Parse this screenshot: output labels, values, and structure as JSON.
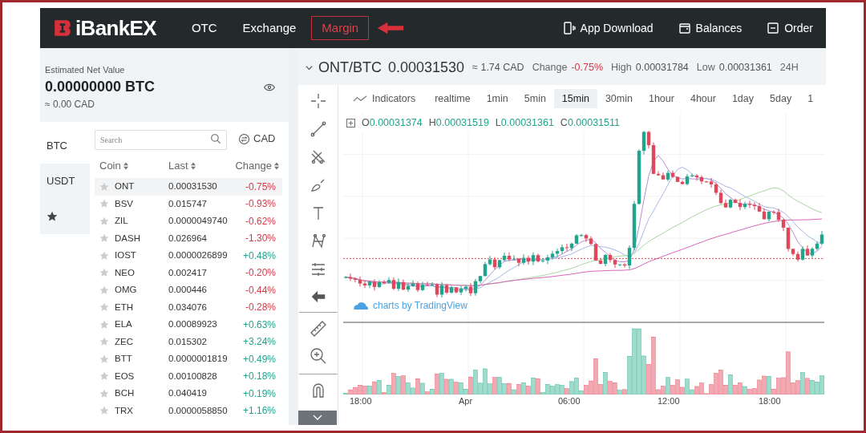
{
  "header": {
    "logo": "iBankEX",
    "nav": [
      {
        "label": "OTC",
        "selected": false
      },
      {
        "label": "Exchange",
        "selected": false
      },
      {
        "label": "Margin",
        "selected": true
      }
    ],
    "actions": [
      {
        "label": "App Download",
        "kind": "app"
      },
      {
        "label": "Balances",
        "kind": "wallet"
      },
      {
        "label": "Order",
        "kind": "order"
      }
    ]
  },
  "account": {
    "label": "Estimated Net Value",
    "value": "0.00000000 BTC",
    "fiat": "≈ 0.00 CAD"
  },
  "market_tabs": [
    {
      "label": "BTC",
      "kind": "text",
      "selected": true
    },
    {
      "label": "USDT",
      "kind": "text",
      "selected": false
    },
    {
      "kind": "favorites",
      "selected": false
    }
  ],
  "search": {
    "placeholder": "Search"
  },
  "currency": "CAD",
  "columns": [
    "Coin",
    "Last",
    "Change"
  ],
  "rows": [
    {
      "coin": "ONT",
      "last": "0.00031530",
      "change": "-0.75%",
      "color": "#d93848",
      "selected": true
    },
    {
      "coin": "BSV",
      "last": "0.015747",
      "change": "-0.93%",
      "color": "#d93848",
      "selected": false
    },
    {
      "coin": "ZIL",
      "last": "0.0000049740",
      "change": "-0.62%",
      "color": "#d93848",
      "selected": false
    },
    {
      "coin": "DASH",
      "last": "0.026964",
      "change": "-1.30%",
      "color": "#d93848",
      "selected": false
    },
    {
      "coin": "IOST",
      "last": "0.0000026899",
      "change": "+0.48%",
      "color": "#1fa58c",
      "selected": false
    },
    {
      "coin": "NEO",
      "last": "0.002417",
      "change": "-0.20%",
      "color": "#d93848",
      "selected": false
    },
    {
      "coin": "OMG",
      "last": "0.000446",
      "change": "-0.44%",
      "color": "#d93848",
      "selected": false
    },
    {
      "coin": "ETH",
      "last": "0.034076",
      "change": "-0.28%",
      "color": "#d93848",
      "selected": false
    },
    {
      "coin": "ELA",
      "last": "0.00089923",
      "change": "+0.63%",
      "color": "#1fa58c",
      "selected": false
    },
    {
      "coin": "ZEC",
      "last": "0.015302",
      "change": "+3.24%",
      "color": "#1fa58c",
      "selected": false
    },
    {
      "coin": "BTT",
      "last": "0.0000001819",
      "change": "+0.49%",
      "color": "#1fa58c",
      "selected": false
    },
    {
      "coin": "EOS",
      "last": "0.00100828",
      "change": "+0.18%",
      "color": "#1fa58c",
      "selected": false
    },
    {
      "coin": "BCH",
      "last": "0.040419",
      "change": "+0.19%",
      "color": "#1fa58c",
      "selected": false
    },
    {
      "coin": "TRX",
      "last": "0.0000058850",
      "change": "+1.16%",
      "color": "#1fa58c",
      "selected": false
    }
  ],
  "ticker": {
    "pair": "ONT/BTC",
    "price": "0.00031530",
    "fiat": "≈ 1.74 CAD",
    "stats": [
      {
        "label": "Change",
        "value": "-0.75%",
        "color": "#d93848"
      },
      {
        "label": "High",
        "value": "0.00031784",
        "color": "#555555"
      },
      {
        "label": "Low",
        "value": "0.00031361",
        "color": "#555555"
      }
    ],
    "extra": "24H"
  },
  "indicators": "Indicators",
  "intervals": [
    {
      "label": "realtime",
      "selected": false
    },
    {
      "label": "1min",
      "selected": false
    },
    {
      "label": "5min",
      "selected": false
    },
    {
      "label": "15min",
      "selected": true
    },
    {
      "label": "30min",
      "selected": false
    },
    {
      "label": "1hour",
      "selected": false
    },
    {
      "label": "4hour",
      "selected": false
    },
    {
      "label": "1day",
      "selected": false
    },
    {
      "label": "5day",
      "selected": false
    },
    {
      "label": "1",
      "selected": false
    }
  ],
  "ohlc": [
    {
      "label": "O",
      "value": "0.00031374"
    },
    {
      "label": "H",
      "value": "0.00031519"
    },
    {
      "label": "L",
      "value": "0.00031361"
    },
    {
      "label": "C",
      "value": "0.00031511"
    }
  ],
  "attribution": "charts by TradingView",
  "time_labels": [
    "18:00",
    "Apr",
    "06:00",
    "12:00",
    "18:00"
  ]
}
